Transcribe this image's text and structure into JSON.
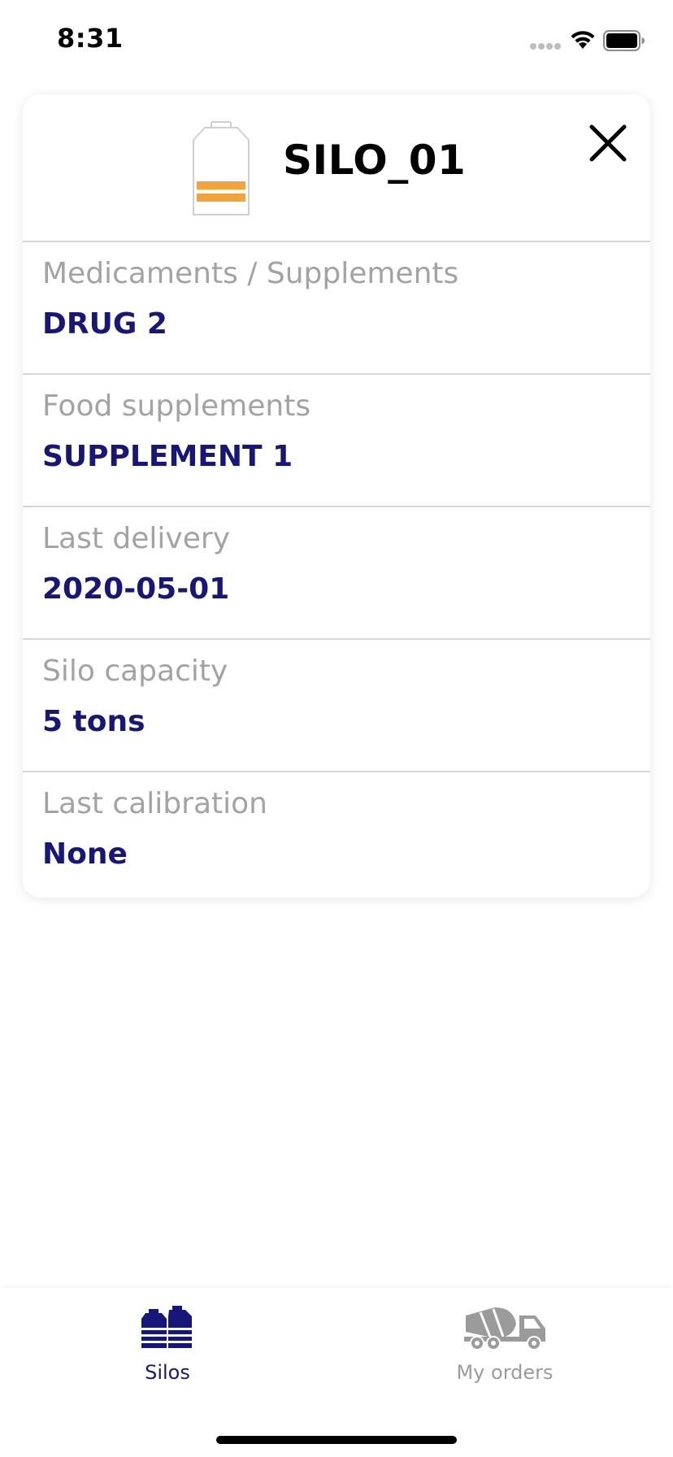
{
  "status_bar": {
    "time": "8:31"
  },
  "silo": {
    "name": "SILO_01",
    "icon": "silo-icon",
    "fill_color": "#f2a33a"
  },
  "details": {
    "medicaments": {
      "label": "Medicaments / Supplements",
      "value": "DRUG 2"
    },
    "food_supplements": {
      "label": "Food supplements",
      "value": "SUPPLEMENT 1"
    },
    "last_delivery": {
      "label": "Last delivery",
      "value": "2020-05-01"
    },
    "silo_capacity": {
      "label": "Silo capacity",
      "value": "5 tons"
    },
    "last_calibration": {
      "label": "Last calibration",
      "value": "None"
    }
  },
  "tab_bar": {
    "tabs": [
      {
        "label": "Silos",
        "icon": "silos-icon",
        "active": true
      },
      {
        "label": "My orders",
        "icon": "truck-icon",
        "active": false
      }
    ]
  },
  "colors": {
    "accent": "#17177a",
    "label_gray": "#a3a3a3",
    "inactive_tab": "#9b9b9b"
  }
}
